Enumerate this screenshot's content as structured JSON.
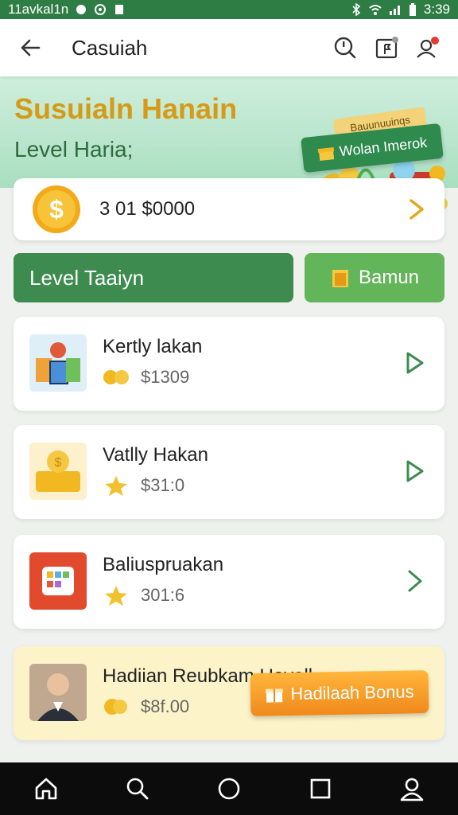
{
  "status_bar": {
    "left_text": "11avkal1n",
    "time": "3:39"
  },
  "app_bar": {
    "title": "Casuiah"
  },
  "hero": {
    "title": "Susuialn Hanain",
    "subtitle": "Level Haria;",
    "tag_text": "Bauunuuinqs",
    "badge_text": "Wolan Imerok"
  },
  "balance": {
    "amount": "3 01 $0000"
  },
  "actions": {
    "level_label": "Level Taaiyn",
    "bonus_label": "Bamun"
  },
  "items": [
    {
      "title": "Kertly lakan",
      "price": "$1309"
    },
    {
      "title": "Vatlly Hakan",
      "price": "$31:0"
    },
    {
      "title": "Baliuspruakan",
      "price": "301:6"
    },
    {
      "title": "Hadiian Reubkam Uevall",
      "price": "$8f.00",
      "button": "Hadilaah Bonus"
    }
  ],
  "colors": {
    "primary_green": "#2e7d45",
    "accent_gold": "#d69a16",
    "bonus_orange": "#f0891c"
  }
}
